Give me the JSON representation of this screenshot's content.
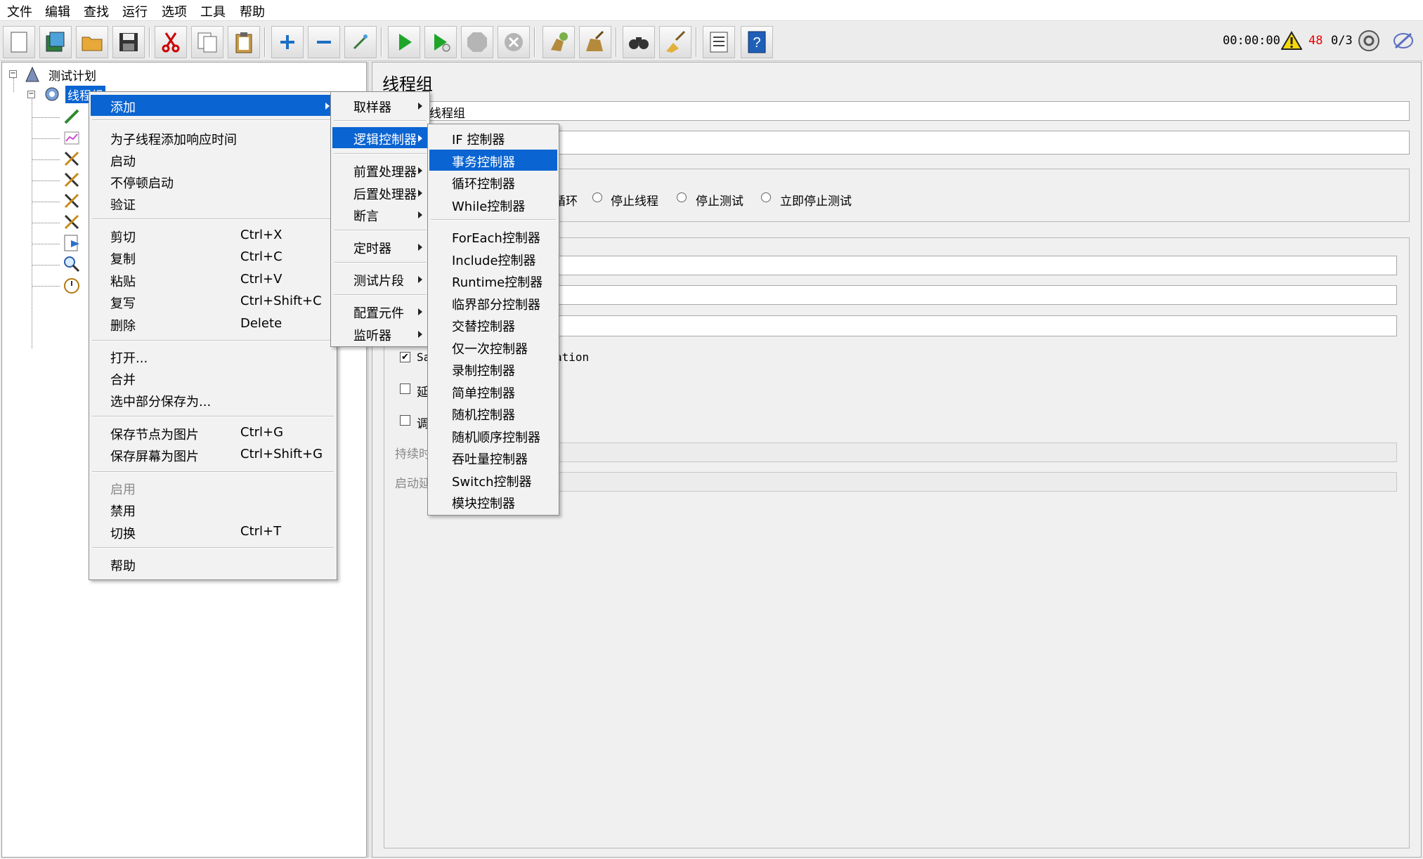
{
  "menubar": [
    "文件",
    "编辑",
    "查找",
    "运行",
    "选项",
    "工具",
    "帮助"
  ],
  "toolbar": {
    "timer": "00:00:00",
    "warn_count": "48",
    "threads": "0/3",
    "accent_color": "#0a64d2",
    "warn_color": "#e00000"
  },
  "tree": {
    "root": "测试计划",
    "selected": "线程组"
  },
  "right": {
    "title": "线程组",
    "name_value": "线程组",
    "radio_options": [
      "循环",
      "停止线程",
      "停止测试",
      "立即停止测试"
    ],
    "checkbox_same_user": "Sa",
    "checkbox_same_user_tail": "ation",
    "checkbox_delay": "延",
    "checkbox_scheduler": "调",
    "label_duration": "持续时",
    "label_startup_delay": "启动延"
  },
  "context_menu": {
    "items": [
      {
        "label": "添加",
        "submenu": true
      },
      {
        "label": "为子线程添加响应时间"
      },
      {
        "label": "启动"
      },
      {
        "label": "不停顿启动"
      },
      {
        "label": "验证"
      },
      {
        "label": "剪切",
        "shortcut": "Ctrl+X"
      },
      {
        "label": "复制",
        "shortcut": "Ctrl+C"
      },
      {
        "label": "粘贴",
        "shortcut": "Ctrl+V"
      },
      {
        "label": "复写",
        "shortcut": "Ctrl+Shift+C"
      },
      {
        "label": "删除",
        "shortcut": "Delete"
      },
      {
        "label": "打开..."
      },
      {
        "label": "合并"
      },
      {
        "label": "选中部分保存为..."
      },
      {
        "label": "保存节点为图片",
        "shortcut": "Ctrl+G"
      },
      {
        "label": "保存屏幕为图片",
        "shortcut": "Ctrl+Shift+G"
      },
      {
        "label": "启用"
      },
      {
        "label": "禁用"
      },
      {
        "label": "切换",
        "shortcut": "Ctrl+T"
      },
      {
        "label": "帮助"
      }
    ]
  },
  "add_submenu": {
    "items": [
      "取样器",
      "逻辑控制器",
      "前置处理器",
      "后置处理器",
      "断言",
      "定时器",
      "测试片段",
      "配置元件",
      "监听器"
    ]
  },
  "logic_submenu": {
    "items": [
      "IF 控制器",
      "事务控制器",
      "循环控制器",
      "While控制器",
      "ForEach控制器",
      "Include控制器",
      "Runtime控制器",
      "临界部分控制器",
      "交替控制器",
      "仅一次控制器",
      "录制控制器",
      "简单控制器",
      "随机控制器",
      "随机顺序控制器",
      "吞吐量控制器",
      "Switch控制器",
      "模块控制器"
    ]
  }
}
